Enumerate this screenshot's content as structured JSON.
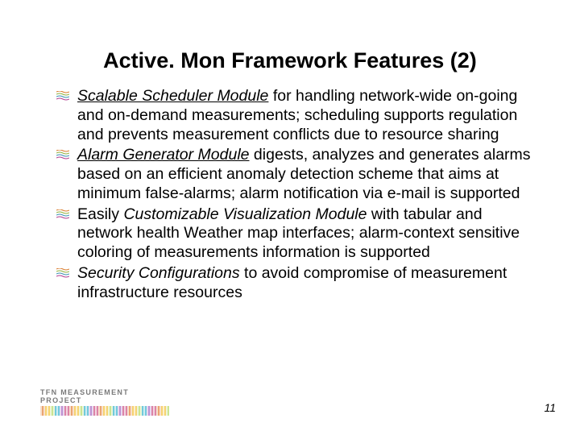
{
  "title": "Active. Mon Framework Features (2)",
  "bullets": [
    {
      "em_u": "Scalable Scheduler Module",
      "rest": " for handling network-wide on-going and on-demand measurements; scheduling supports regulation and prevents measurement conflicts due to resource sharing"
    },
    {
      "em_u": "Alarm Generator Module",
      "rest": " digests, analyzes and generates alarms based on an efficient anomaly detection scheme that aims at minimum false-alarms; alarm notification via e-mail is supported"
    },
    {
      "pre": "Easily ",
      "em": "Customizable Visualization Module",
      "rest": " with tabular and network health Weather map interfaces; alarm-context sensitive coloring of measurements information is supported"
    },
    {
      "em": "Security Configurations",
      "rest": " to avoid compromise of measurement infrastructure resources"
    }
  ],
  "footer": {
    "project_label": "TFN MEASUREMENT PROJECT"
  },
  "page_number": "11"
}
